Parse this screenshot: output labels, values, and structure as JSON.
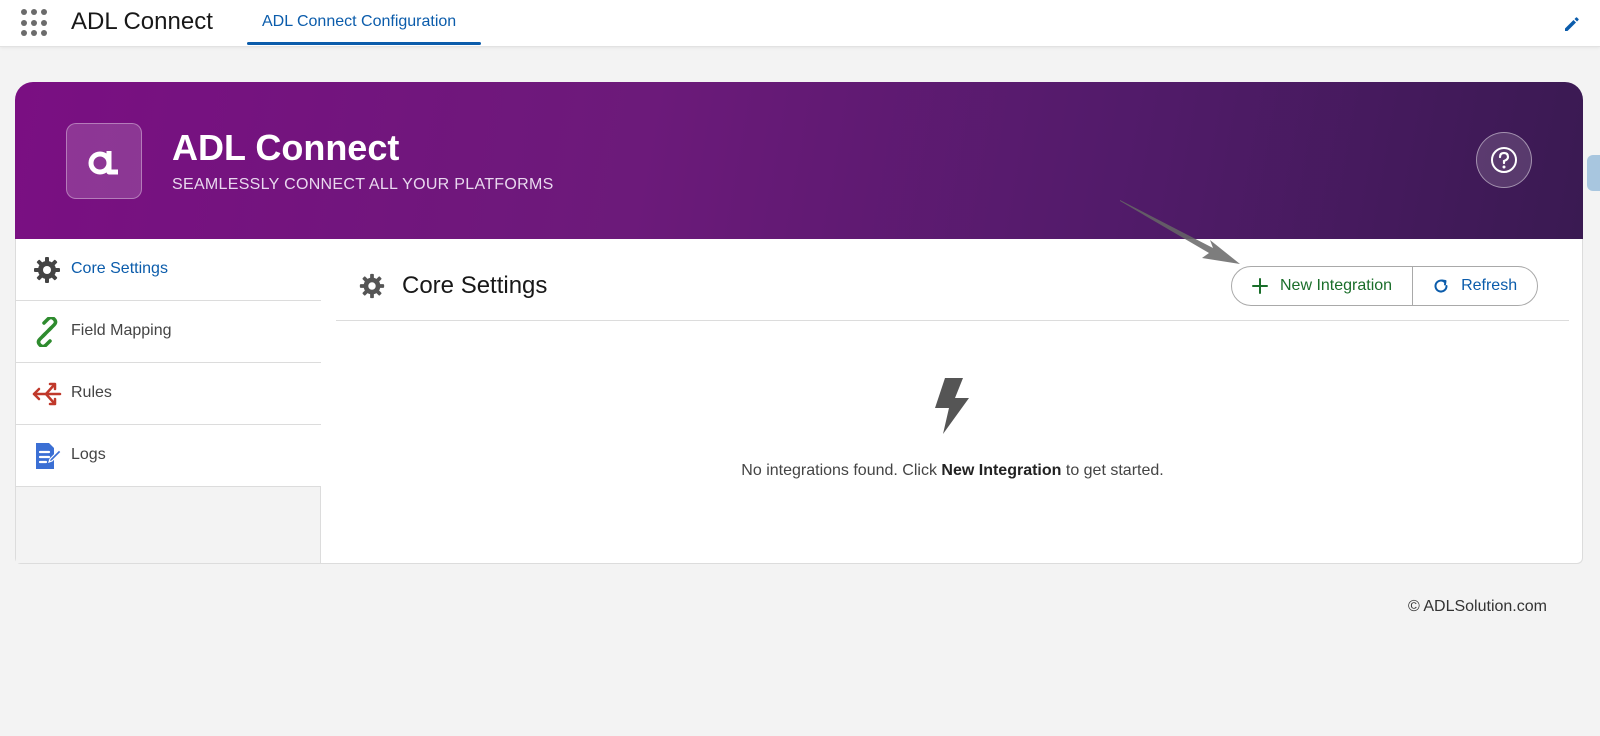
{
  "topnav": {
    "app_name": "ADL Connect",
    "tab_label": "ADL Connect Configuration"
  },
  "hero": {
    "title": "ADL Connect",
    "subtitle": "SEAMLESSLY CONNECT ALL YOUR PLATFORMS",
    "help_label": "?"
  },
  "sidebar": {
    "items": [
      {
        "label": "Core Settings",
        "icon": "gear-icon"
      },
      {
        "label": "Field Mapping",
        "icon": "link-icon"
      },
      {
        "label": "Rules",
        "icon": "split-arrows-icon"
      },
      {
        "label": "Logs",
        "icon": "document-list-icon"
      }
    ]
  },
  "content": {
    "title": "Core Settings",
    "new_button": "New Integration",
    "refresh_button": "Refresh",
    "empty_prefix": "No integrations found. Click ",
    "empty_bold": "New Integration",
    "empty_suffix": " to get started."
  },
  "footer": {
    "copyright": "© ADLSolution.com"
  },
  "colors": {
    "brand_purple": "#7a0f82",
    "link_blue": "#0b5cab",
    "success_green": "#1a6e2a"
  }
}
